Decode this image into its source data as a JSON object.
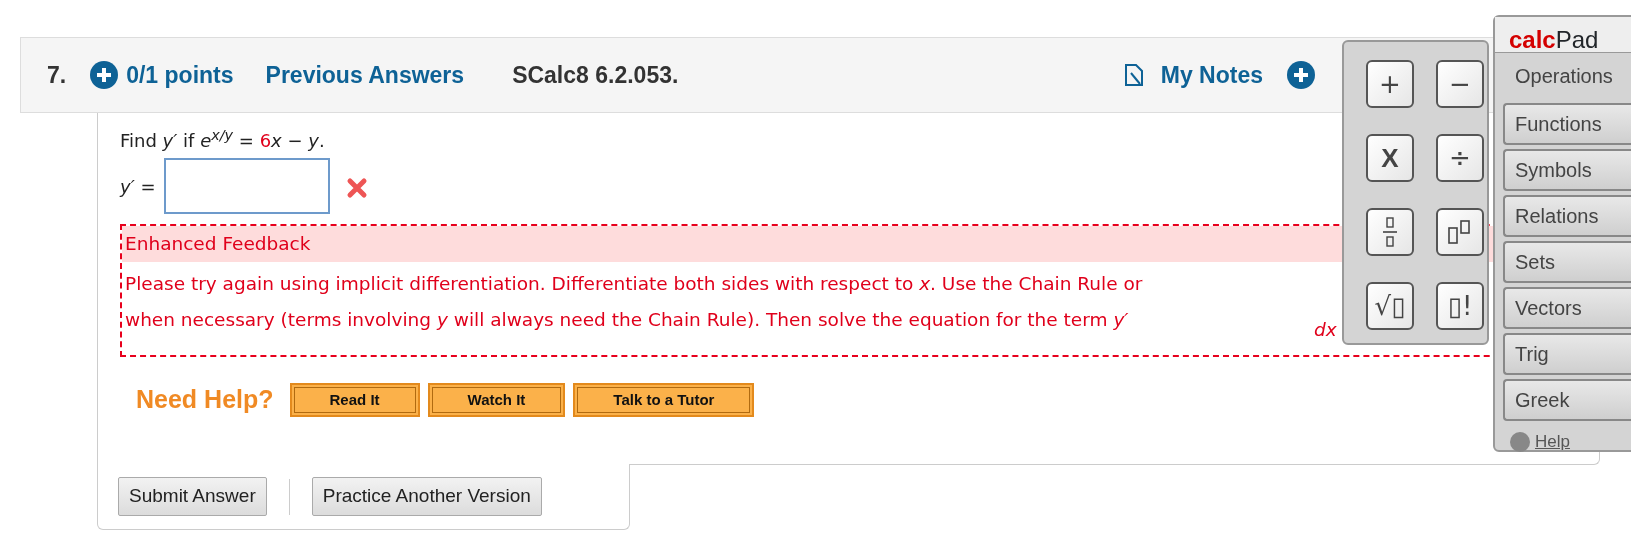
{
  "question": {
    "number": "7.",
    "points": "0/1 points",
    "previous": "Previous Answers",
    "source": "SCalc8 6.2.053.",
    "notes": "My Notes"
  },
  "prompt": [
    {
      "text": "Find ",
      "kind": "plain"
    },
    {
      "text": "y′",
      "kind": "var"
    },
    {
      "text": " if  ",
      "kind": "plain"
    },
    {
      "text": "e",
      "kind": "var"
    },
    {
      "text": "x/y",
      "kind": "sup"
    },
    {
      "text": " = ",
      "kind": "plain"
    },
    {
      "text": "6",
      "kind": "random"
    },
    {
      "text": "x",
      "kind": "var"
    },
    {
      "text": " − ",
      "kind": "plain"
    },
    {
      "text": "y",
      "kind": "var"
    },
    {
      "text": ".",
      "kind": "plain"
    }
  ],
  "answer": {
    "label": "*y′* =",
    "wrong": true
  },
  "feedback": {
    "title": "Enhanced Feedback",
    "lines": [
      "Please try again using implicit differentiation. Differentiate both sides with respect to *x*. Use the Chain Rule or",
      "when necessary (terms involving *y* will always need the Chain Rule). Then solve the equation for the term  *y′*"
    ],
    "fraction_part": "dx"
  },
  "help": {
    "label": "Need Help?",
    "buttons": [
      "Read It",
      "Watch It",
      "Talk to a Tutor"
    ]
  },
  "actions": [
    "Submit Answer",
    "Practice Another Version"
  ],
  "calcpad": {
    "logo": [
      "calc",
      "Pad"
    ],
    "keys": [
      {
        "kind": "text",
        "label": "+"
      },
      {
        "kind": "text",
        "label": "−"
      },
      {
        "kind": "bold",
        "label": "X"
      },
      {
        "kind": "text",
        "label": "÷"
      },
      {
        "kind": "fraction"
      },
      {
        "kind": "power"
      },
      {
        "kind": "text",
        "label": "√▯"
      },
      {
        "kind": "text",
        "label": "▯!"
      }
    ],
    "tabs": [
      {
        "label": "Operations",
        "selected": true
      },
      {
        "label": "Functions",
        "selected": false
      },
      {
        "label": "Symbols",
        "selected": false
      },
      {
        "label": "Relations",
        "selected": false
      },
      {
        "label": "Sets",
        "selected": false
      },
      {
        "label": "Vectors",
        "selected": false
      },
      {
        "label": "Trig",
        "selected": false
      },
      {
        "label": "Greek",
        "selected": false
      }
    ],
    "help": "Help"
  }
}
